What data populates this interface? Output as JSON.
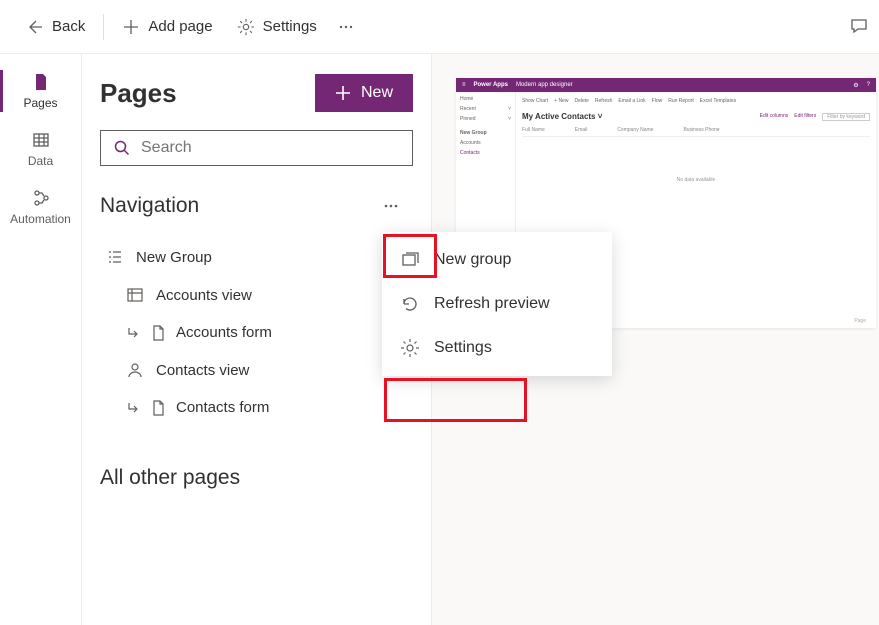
{
  "topbar": {
    "back": "Back",
    "add_page": "Add page",
    "settings": "Settings"
  },
  "rail": {
    "pages": "Pages",
    "data": "Data",
    "automation": "Automation"
  },
  "panel": {
    "title": "Pages",
    "new_btn": "New",
    "search_placeholder": "Search",
    "nav_title": "Navigation",
    "all_other": "All other pages",
    "items": {
      "group": "New Group",
      "accounts_view": "Accounts view",
      "accounts_form": "Accounts form",
      "contacts_view": "Contacts view",
      "contacts_form": "Contacts form"
    }
  },
  "menu": {
    "new_group": "New group",
    "refresh": "Refresh preview",
    "settings": "Settings"
  },
  "preview": {
    "app_name": "Power Apps",
    "subtitle": "Modern app designer",
    "side": {
      "home": "Home",
      "recent": "Recent",
      "pinned": "Pinned",
      "group_label": "New Group",
      "accounts": "Accounts",
      "contacts": "Contacts"
    },
    "toolbar": {
      "show_chart": "Show Chart",
      "new": "New",
      "delete": "Delete",
      "refresh": "Refresh",
      "email_link": "Email a Link",
      "flow": "Flow",
      "run_report": "Run Report",
      "excel": "Excel Templates"
    },
    "view_title": "My Active Contacts",
    "edit_columns": "Edit columns",
    "edit_filters": "Edit filters",
    "filter_placeholder": "Filter by keyword",
    "cols": {
      "fullname": "Full Name",
      "email": "Email",
      "company": "Company Name",
      "phone": "Business Phone"
    },
    "nodata": "No data available",
    "page_label": "Page"
  }
}
